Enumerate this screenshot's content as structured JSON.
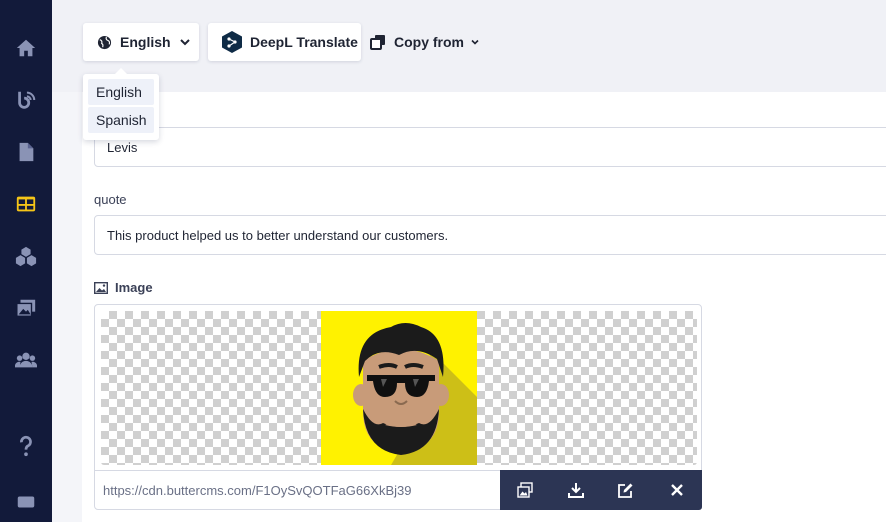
{
  "sidebar": {
    "items": [
      {
        "icon": "home-icon"
      },
      {
        "icon": "blog-icon"
      },
      {
        "icon": "page-icon"
      },
      {
        "icon": "collections-icon",
        "active": true
      },
      {
        "icon": "components-icon"
      },
      {
        "icon": "media-icon"
      },
      {
        "icon": "users-icon"
      },
      {
        "icon": "help-icon"
      },
      {
        "icon": "chat-icon"
      }
    ],
    "active_color": "#f5c518"
  },
  "toolbar": {
    "locale_label": "English",
    "deepl_label": "DeepL Translate",
    "copy_label": "Copy from"
  },
  "locale_dropdown": {
    "options": [
      "English",
      "Spanish"
    ]
  },
  "fields": {
    "name_value": "Levis",
    "quote_label": "quote",
    "quote_value": "This product helped us to better understand our customers.",
    "image_label": "Image",
    "image_url": "https://cdn.buttercms.com/F1OySvQOTFaG66XkBj39"
  },
  "image_actions": [
    "media-library-icon",
    "download-icon",
    "edit-icon",
    "close-icon"
  ],
  "colors": {
    "sidebar_bg": "#121a3a",
    "image_toolbar_bg": "#2c3554",
    "avatar_bg": "#fff200"
  }
}
